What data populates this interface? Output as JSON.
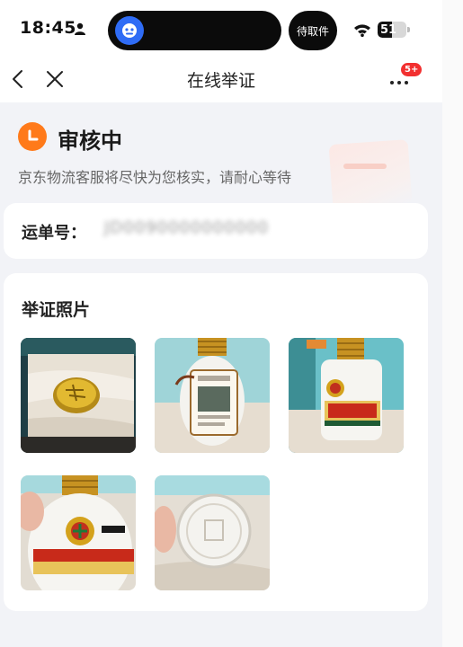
{
  "status_bar": {
    "time": "18:45",
    "pill_label": "待取件",
    "battery": "51",
    "battery_level": 0.51,
    "icons": [
      "person-icon",
      "wifi-icon",
      "battery-icon"
    ]
  },
  "nav": {
    "title": "在线举证",
    "more_badge": "5+",
    "icons": [
      "back-icon",
      "close-icon",
      "more-icon"
    ]
  },
  "status": {
    "title": "审核中",
    "description": "京东物流客服将尽快为您核实，请耐心等待",
    "accent_color": "#ff7a1a"
  },
  "waybill": {
    "label": "运单号：",
    "value": "JD0090000000000"
  },
  "evidence": {
    "title": "举证照片",
    "photos": [
      {
        "subject": "gift-box-lid-photo"
      },
      {
        "subject": "bottle-back-label-photo"
      },
      {
        "subject": "bottle-front-label-photo"
      },
      {
        "subject": "bottle-neck-closeup-photo"
      },
      {
        "subject": "bottle-base-photo"
      }
    ]
  }
}
